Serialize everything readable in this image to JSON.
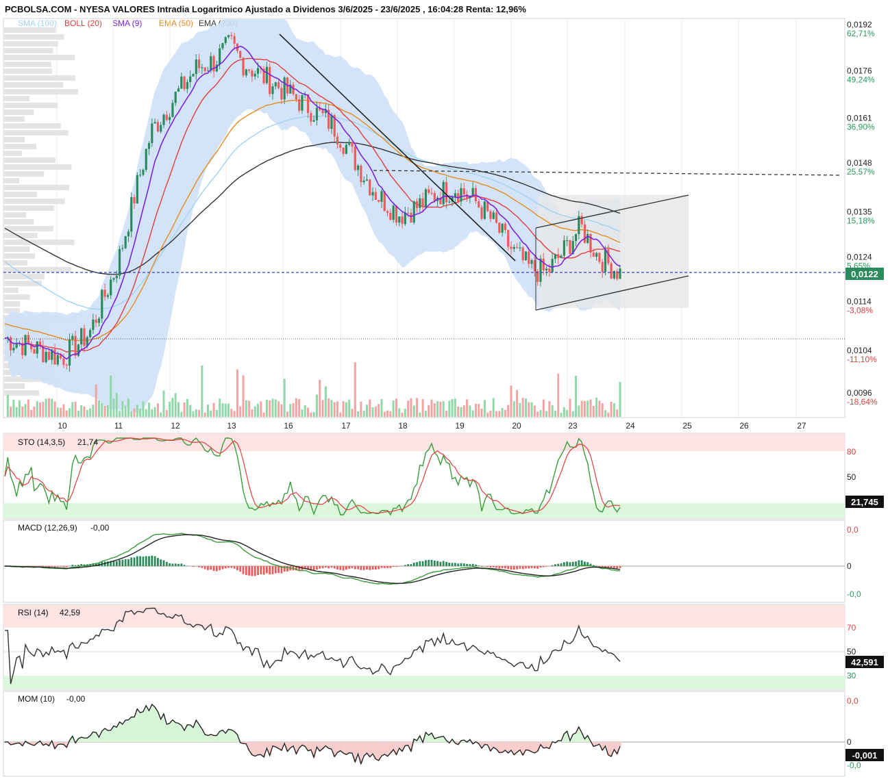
{
  "header": {
    "title": "PCBOLSA.COM - NYESA VALORES Intradia Logaritmico Ajustado a Dividenos 3/6/2025 - 23/6/2025 , 16:04:28 Renta: 12,96%"
  },
  "legend": [
    {
      "label": "SMA (100)",
      "color": "#9fd3f2"
    },
    {
      "label": "BOLL (20)",
      "color": "#e33b3b"
    },
    {
      "label": "SMA (9)",
      "color": "#7a22e0"
    },
    {
      "label": "EMA (50)",
      "color": "#e58a1f"
    },
    {
      "label": "EMA (200)",
      "color": "#333333"
    }
  ],
  "colors": {
    "up": "#2a8a5c",
    "down": "#ef5b5b",
    "boll_fill": "#cfe1f7",
    "current_price_badge": "#2a8a5c",
    "oversold_zone": "#dcf7dc",
    "overbought_zone": "#fde3e3"
  },
  "price_axis": [
    {
      "price": "0,0192",
      "pct": "62,71%",
      "pct_color": "#2a9a5c"
    },
    {
      "price": "0,0176",
      "pct": "49,24%",
      "pct_color": "#2a9a5c"
    },
    {
      "price": "0,0161",
      "pct": "36,90%",
      "pct_color": "#2a9a5c"
    },
    {
      "price": "0,0148",
      "pct": "25,57%",
      "pct_color": "#2a9a5c"
    },
    {
      "price": "0,0135",
      "pct": "15,18%",
      "pct_color": "#2a9a5c"
    },
    {
      "price": "0,0124",
      "pct": "5,65%",
      "pct_color": "#2a9a5c"
    },
    {
      "price": "0,0114",
      "pct": "-3,08%",
      "pct_color": "#e04040"
    },
    {
      "price": "0,0104",
      "pct": "-11,10%",
      "pct_color": "#e04040"
    },
    {
      "price": "0,0096",
      "pct": "-18,64%",
      "pct_color": "#e04040"
    }
  ],
  "current_price": "0,0122",
  "dates": [
    "10",
    "11",
    "12",
    "13",
    "16",
    "17",
    "18",
    "19",
    "20",
    "23",
    "24",
    "25",
    "26",
    "27"
  ],
  "panels": {
    "sto": {
      "label": "STO (14,3,5)",
      "value": "21,74",
      "badge": "21,745",
      "levels": [
        "80",
        "50"
      ]
    },
    "macd": {
      "label": "MACD (12,26,9)",
      "value": "-0,00",
      "levels": [
        "0,0",
        "0",
        "-0,0"
      ]
    },
    "rsi": {
      "label": "RSI (14)",
      "value": "42,59",
      "badge": "42,591",
      "levels": [
        "70",
        "50",
        "30"
      ]
    },
    "mom": {
      "label": "MOM (10)",
      "value": "-0,00",
      "badge": "-0,001",
      "levels": [
        "0,0",
        "0",
        "-0,0"
      ]
    }
  },
  "chart_data": {
    "type": "line",
    "scale": "log",
    "price_path": [
      [
        0,
        0.0107
      ],
      [
        0.8,
        0.0104
      ],
      [
        1,
        0.0103
      ],
      [
        1.5,
        0.0108
      ],
      [
        2,
        0.0123
      ],
      [
        2.3,
        0.014
      ],
      [
        2.6,
        0.0158
      ],
      [
        3,
        0.0168
      ],
      [
        3.4,
        0.0178
      ],
      [
        3.7,
        0.018
      ],
      [
        4,
        0.0186
      ],
      [
        4.2,
        0.018
      ],
      [
        4.5,
        0.0176
      ],
      [
        5,
        0.017
      ],
      [
        5.4,
        0.0165
      ],
      [
        5.8,
        0.016
      ],
      [
        6,
        0.0155
      ],
      [
        6.3,
        0.0147
      ],
      [
        6.6,
        0.014
      ],
      [
        7,
        0.0135
      ],
      [
        7.3,
        0.0137
      ],
      [
        7.6,
        0.014
      ],
      [
        8,
        0.0142
      ],
      [
        8.3,
        0.0139
      ],
      [
        8.6,
        0.0134
      ],
      [
        9,
        0.0126
      ],
      [
        9.3,
        0.0122
      ],
      [
        9.6,
        0.0121
      ],
      [
        9.9,
        0.0126
      ],
      [
        10.2,
        0.0132
      ],
      [
        10.5,
        0.0125
      ],
      [
        10.9,
        0.0121
      ]
    ]
  }
}
